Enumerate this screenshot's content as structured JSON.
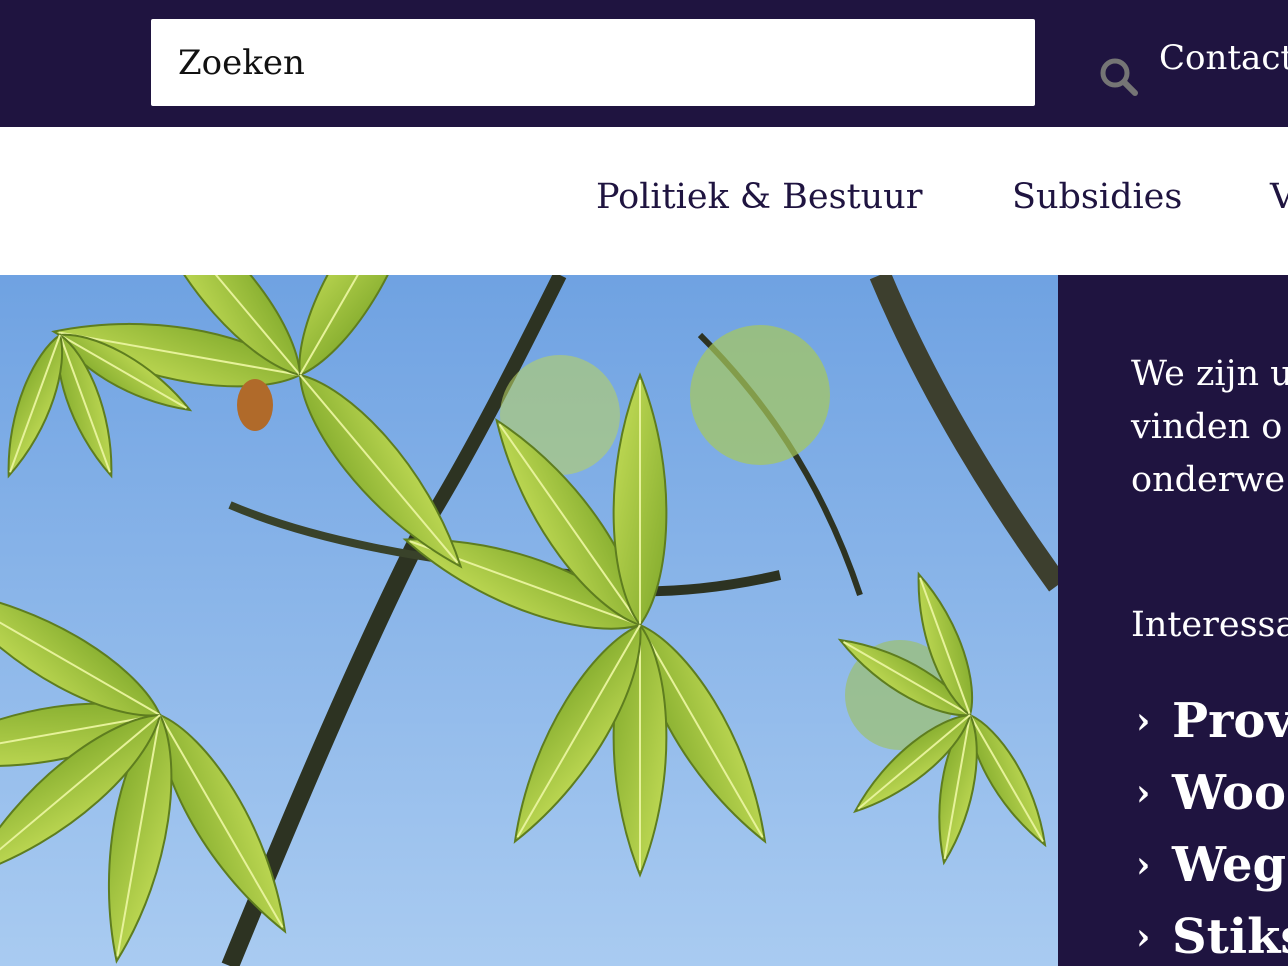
{
  "header": {
    "search": {
      "placeholder": "Zoeken",
      "icon": "search-icon"
    },
    "contact_label": "Contact"
  },
  "nav": {
    "items": [
      {
        "label": "Politiek & Bestuur"
      },
      {
        "label": "Subsidies"
      },
      {
        "label": "V"
      }
    ]
  },
  "hero": {
    "image_subject": "chestnut-leaves-against-blue-sky"
  },
  "side_panel": {
    "intro_lines": [
      "We zijn u",
      "vinden o",
      "onderwe"
    ],
    "interesting_label": "Interessa",
    "links": [
      {
        "chevron": "›",
        "label": "Prov"
      },
      {
        "chevron": "›",
        "label": "Woo"
      },
      {
        "chevron": "›",
        "label": "Weg"
      },
      {
        "chevron": "›",
        "label": "Stiks"
      }
    ]
  },
  "colors": {
    "brand_dark": "#1f1440",
    "white": "#ffffff",
    "sky_blue": "#8ab6ea",
    "leaf_green": "#a9cf3a"
  }
}
